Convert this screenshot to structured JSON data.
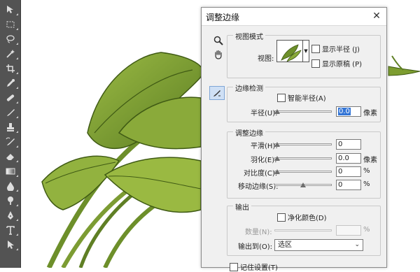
{
  "toolbar": {
    "tools": [
      {
        "name": "move-tool-icon"
      },
      {
        "name": "marquee-tool-icon"
      },
      {
        "name": "lasso-tool-icon"
      },
      {
        "name": "magic-wand-tool-icon"
      },
      {
        "name": "crop-tool-icon"
      },
      {
        "name": "eyedropper-tool-icon"
      },
      {
        "name": "healing-brush-tool-icon"
      },
      {
        "name": "brush-tool-icon"
      },
      {
        "name": "clone-stamp-tool-icon"
      },
      {
        "name": "history-brush-tool-icon"
      },
      {
        "name": "eraser-tool-icon"
      },
      {
        "name": "gradient-tool-icon"
      },
      {
        "name": "blur-tool-icon"
      },
      {
        "name": "dodge-tool-icon"
      },
      {
        "name": "pen-tool-icon"
      },
      {
        "name": "type-tool-icon"
      },
      {
        "name": "path-selection-tool-icon"
      }
    ]
  },
  "dialog": {
    "title": "调整边缘",
    "close_glyph": "✕",
    "side_tools": {
      "zoom_icon": "zoom-icon",
      "hand_icon": "hand-icon",
      "refine_radius_icon": "refine-radius-brush-icon"
    },
    "view_mode": {
      "group_title": "视图模式",
      "view_label": "视图:",
      "show_radius": "显示半径 (J)",
      "show_original": "显示原稿 (P)"
    },
    "edge_detection": {
      "group_title": "边缘检测",
      "smart_radius": "智能半径(A)",
      "radius_label": "半径(U):",
      "radius_value": "0.0",
      "radius_unit": "像素",
      "radius_level": 0
    },
    "adjust_edge": {
      "group_title": "调整边缘",
      "smooth_label": "平滑(H):",
      "smooth_value": "0",
      "smooth_level": 0,
      "feather_label": "羽化(E):",
      "feather_value": "0.0",
      "feather_unit": "像素",
      "feather_level": 0,
      "contrast_label": "对比度(C):",
      "contrast_value": "0",
      "contrast_unit": "%",
      "contrast_level": 0,
      "shift_label": "移动边缘(S):",
      "shift_value": "0",
      "shift_unit": "%",
      "shift_level": 0.5
    },
    "output": {
      "group_title": "输出",
      "decontaminate": "净化颜色(D)",
      "amount_label": "数量(N):",
      "amount_value": "",
      "amount_unit": "%",
      "output_to_label": "输出到(O):",
      "output_to_value": "选区",
      "chevron": "⌄"
    },
    "remember": "记住设置(T)"
  },
  "colors": {
    "leaf_light": "#8bab3b",
    "leaf_dark": "#4d6b1b",
    "stem": "#6d8f2a",
    "toolbar_bg": "#535353",
    "selection": "#3375d6"
  }
}
